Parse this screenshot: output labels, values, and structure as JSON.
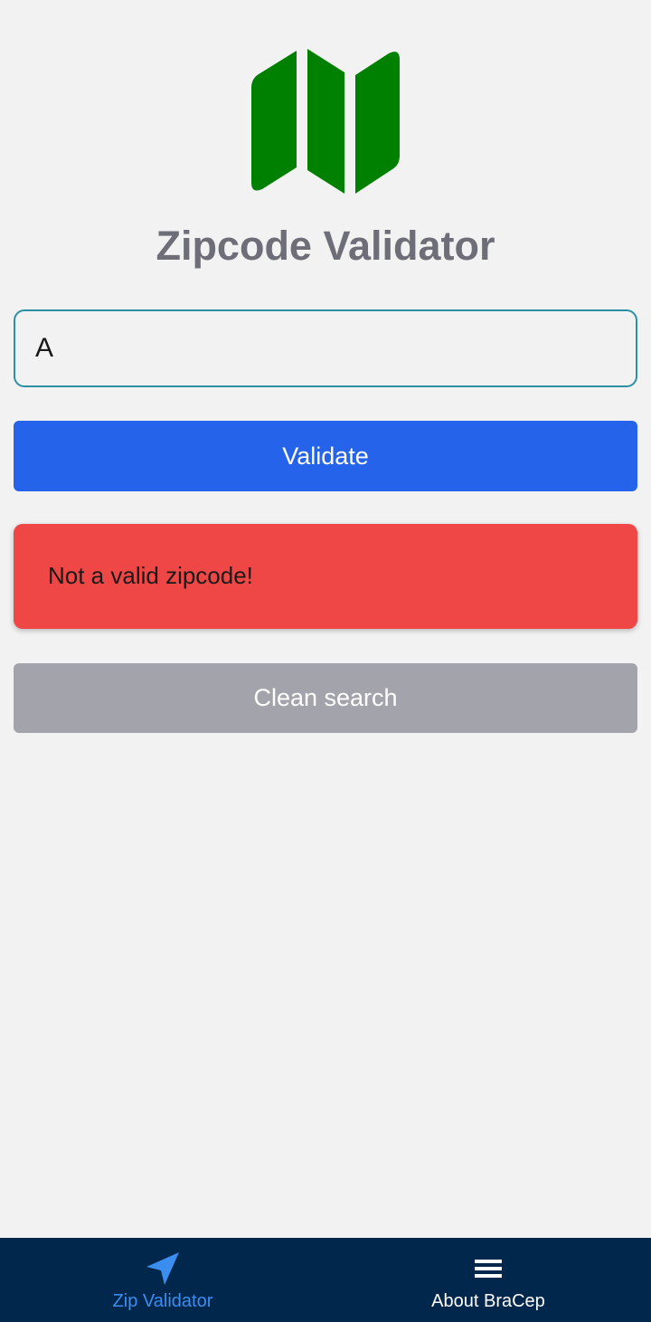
{
  "colors": {
    "background": "#f2f2f2",
    "logo_green": "#008000",
    "title": "#6e6e78",
    "validate_button": "#2563eb",
    "error_box": "#ef4646",
    "clean_button": "#a3a3ab",
    "tabbar": "#02274c",
    "active_tab": "#3b8df0"
  },
  "header": {
    "logo_icon": "map-icon",
    "title": "Zipcode Validator"
  },
  "form": {
    "zip_value": "A",
    "validate_label": "Validate",
    "error_message": "Not a valid zipcode!",
    "clean_label": "Clean search"
  },
  "tabbar": {
    "tabs": [
      {
        "label": "Zip Validator",
        "icon": "navigation-arrow-icon",
        "active": true
      },
      {
        "label": "About BraCep",
        "icon": "hamburger-menu-icon",
        "active": false
      }
    ]
  }
}
